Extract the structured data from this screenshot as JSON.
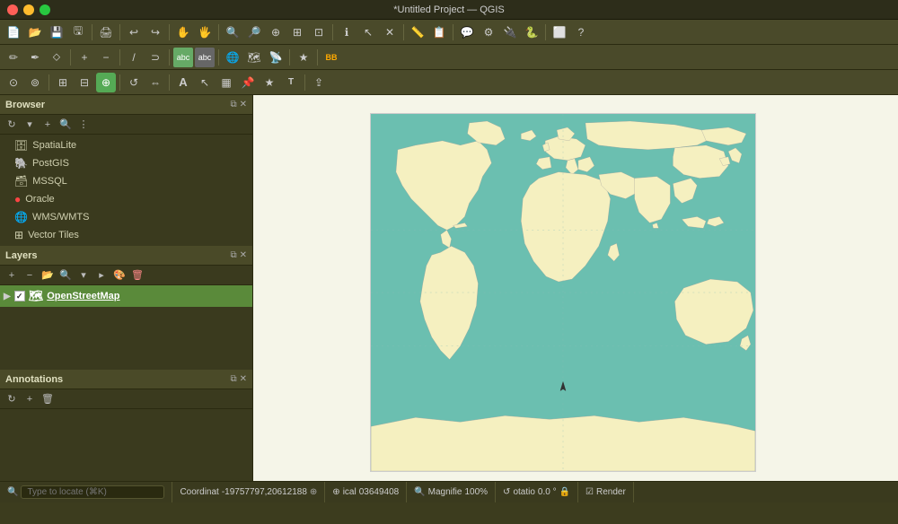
{
  "window": {
    "title": "*Untitled Project — QGIS"
  },
  "browser": {
    "title": "Browser",
    "items": [
      {
        "icon": "🗄",
        "label": "SpatiaLite"
      },
      {
        "icon": "🐘",
        "label": "PostGIS"
      },
      {
        "icon": "🗃",
        "label": "MSSQL"
      },
      {
        "icon": "🔴",
        "label": "Oracle"
      },
      {
        "icon": "🌐",
        "label": "WMS/WMTS"
      },
      {
        "icon": "⊞",
        "label": "Vector Tiles"
      }
    ]
  },
  "layers": {
    "title": "Layers",
    "items": [
      {
        "label": "OpenStreetMap",
        "visible": true
      }
    ]
  },
  "annotations": {
    "title": "Annotations"
  },
  "status": {
    "locate_placeholder": "Type to locate (⌘K)",
    "coordinate_label": "Coordinat",
    "coordinate_value": "-19757797,20612188",
    "scale_label": "ical",
    "scale_value": "03649408",
    "magnify_label": "Magnifie",
    "magnify_value": "100%",
    "rotation_label": "otatio",
    "rotation_value": "0.0 °",
    "render_label": "Render"
  },
  "toolbar": {
    "rows": 3
  }
}
